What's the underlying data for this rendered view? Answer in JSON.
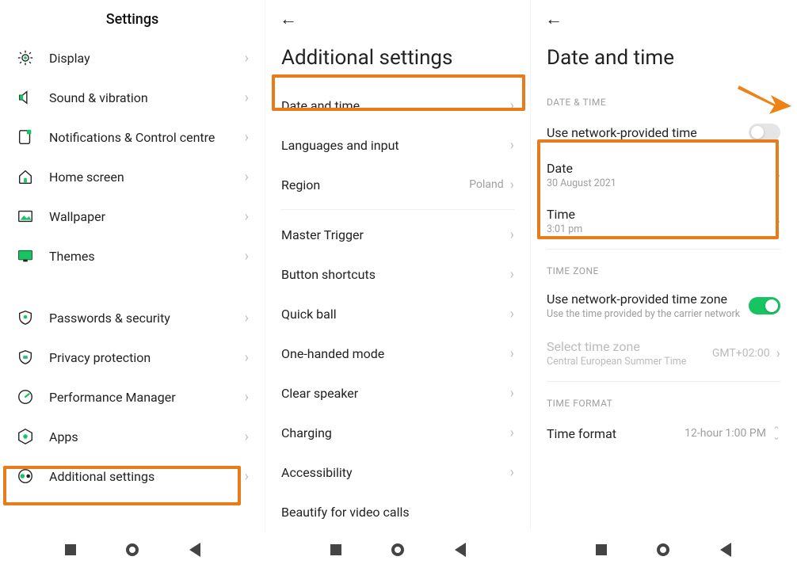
{
  "screen1": {
    "title": "Settings",
    "items": [
      {
        "icon": "display",
        "label": "Display"
      },
      {
        "icon": "sound",
        "label": "Sound & vibration"
      },
      {
        "icon": "notifications",
        "label": "Notifications & Control centre"
      },
      {
        "icon": "home",
        "label": "Home screen"
      },
      {
        "icon": "wallpaper",
        "label": "Wallpaper"
      },
      {
        "icon": "themes",
        "label": "Themes"
      }
    ],
    "items2": [
      {
        "icon": "passwords",
        "label": "Passwords & security"
      },
      {
        "icon": "privacy",
        "label": "Privacy protection"
      },
      {
        "icon": "performance",
        "label": "Performance Manager"
      },
      {
        "icon": "apps",
        "label": "Apps"
      },
      {
        "icon": "additional",
        "label": "Additional settings"
      }
    ]
  },
  "screen2": {
    "title": "Additional settings",
    "group1": [
      {
        "label": "Date and time",
        "value": ""
      },
      {
        "label": "Languages and input",
        "value": ""
      },
      {
        "label": "Region",
        "value": "Poland"
      }
    ],
    "group2": [
      {
        "label": "Master Trigger"
      },
      {
        "label": "Button shortcuts"
      },
      {
        "label": "Quick ball"
      },
      {
        "label": "One-handed mode"
      },
      {
        "label": "Clear speaker"
      },
      {
        "label": "Charging"
      },
      {
        "label": "Accessibility"
      },
      {
        "label": "Beautify for video calls"
      }
    ]
  },
  "screen3": {
    "title": "Date and time",
    "sectionDateTime": "DATE & TIME",
    "useNetworkTime": "Use network-provided time",
    "dateLabel": "Date",
    "dateValue": "30 August 2021",
    "timeLabel": "Time",
    "timeValue": "3:01 pm",
    "sectionTimeZone": "TIME ZONE",
    "useNetworkZone": "Use network-provided time zone",
    "useNetworkZoneSub": "Use the time provided by the carrier network",
    "selectTz": "Select time zone",
    "selectTzSub": "Central European Summer Time",
    "gmt": "GMT+02:00",
    "sectionTimeFormat": "TIME FORMAT",
    "timeFormatLabel": "Time format",
    "timeFormatValue": "12-hour 1:00 PM"
  }
}
